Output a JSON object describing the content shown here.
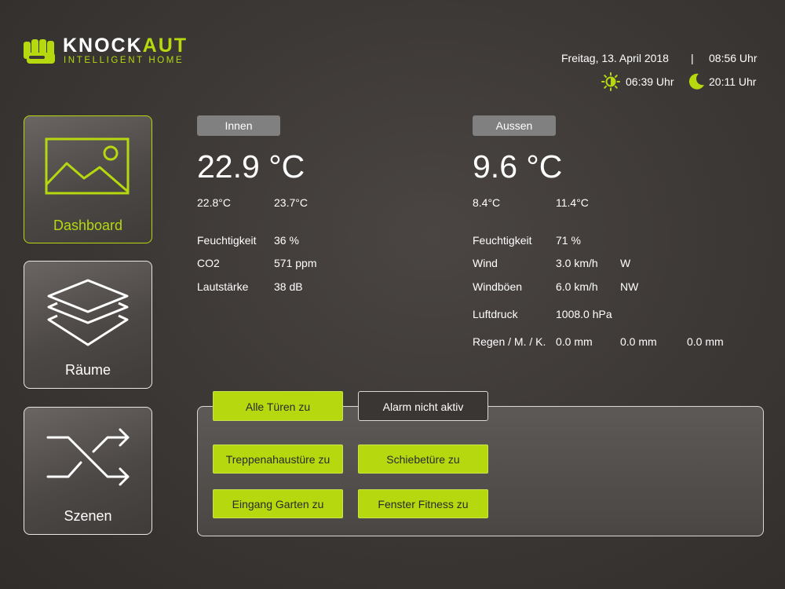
{
  "brand": {
    "name_part1": "KNOCK",
    "name_part2": "AUT",
    "tagline": "INTELLIGENT HOME",
    "accent_color": "#b5d80f"
  },
  "header": {
    "date": "Freitag, 13. April 2018",
    "separator": "|",
    "time": "08:56 Uhr",
    "sunrise": "06:39 Uhr",
    "sunset": "20:11 Uhr",
    "sunrise_icon": "sun-icon",
    "sunset_icon": "moon-icon"
  },
  "nav": [
    {
      "label": "Dashboard",
      "icon": "image-icon",
      "active": true
    },
    {
      "label": "Räume",
      "icon": "layers-icon",
      "active": false
    },
    {
      "label": "Szenen",
      "icon": "shuffle-icon",
      "active": false
    }
  ],
  "inside": {
    "title": "Innen",
    "temp": "22.9 °C",
    "min": "22.8°C",
    "max": "23.7°C",
    "rows": [
      {
        "label": "Feuchtigkeit",
        "value": "36 %"
      },
      {
        "label": "CO2",
        "value": "571 ppm"
      },
      {
        "label": "Lautstärke",
        "value": "38 dB"
      }
    ]
  },
  "outside": {
    "title": "Aussen",
    "temp": "9.6 °C",
    "min": "8.4°C",
    "max": "11.4°C",
    "humidity_label": "Feuchtigkeit",
    "humidity": "71 %",
    "wind_label": "Wind",
    "wind": "3.0 km/h",
    "wind_dir": "W",
    "gust_label": "Windböen",
    "gust": "6.0 km/h",
    "gust_dir": "NW",
    "pressure_label": "Luftdruck",
    "pressure": "1008.0 hPa",
    "rain_label": "Regen / M. / K.",
    "rain": [
      "0.0 mm",
      "0.0 mm",
      "0.0 mm"
    ]
  },
  "controls": {
    "tab_doors": "Alle Türen zu",
    "tab_alarm": "Alarm nicht aktiv",
    "buttons": [
      "Treppenahaustüre zu",
      "Schiebetüre zu",
      "Eingang Garten zu",
      "Fenster Fitness zu"
    ]
  }
}
